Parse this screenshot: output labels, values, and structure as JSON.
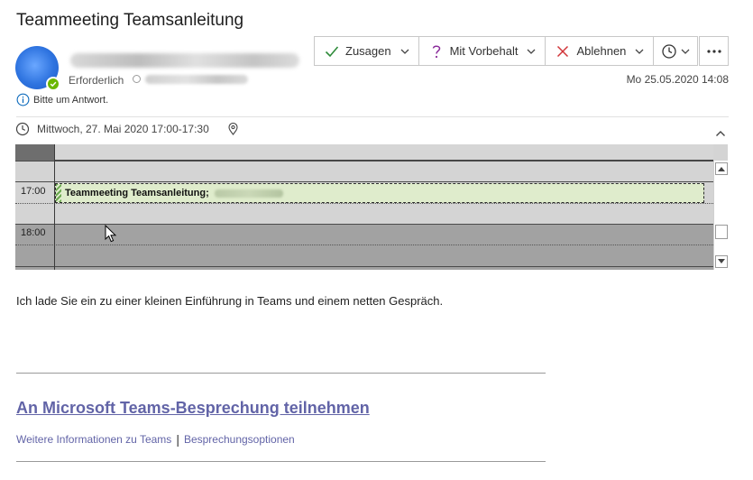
{
  "meeting": {
    "title": "Teammeeting Teamsanleitung",
    "required_label": "Erforderlich",
    "response_note": "Bitte um Antwort.",
    "sent_date": "Mo 25.05.2020 14:08",
    "when": "Mittwoch, 27. Mai 2020 17:00-17:30"
  },
  "toolbar": {
    "accept_label": "Zusagen",
    "tentative_label": "Mit Vorbehalt",
    "decline_label": "Ablehnen"
  },
  "calendar": {
    "times": [
      "17:00",
      "18:00"
    ],
    "event_label": "Teammeeting Teamsanleitung;"
  },
  "body": {
    "message": "Ich lade Sie ein zu einer kleinen Einführung in Teams und einem netten Gespräch.",
    "join_link": "An Microsoft Teams-Besprechung teilnehmen",
    "more_info_link": "Weitere Informationen zu Teams",
    "separator": "|",
    "options_link": "Besprechungsoptionen"
  },
  "colors": {
    "accept": "#2e8b3a",
    "tentative": "#8b2d9b",
    "decline": "#d13438",
    "presence": "#6bb700",
    "teams_link": "#6264a7",
    "event_fill": "#dfeccc"
  },
  "icons": {
    "presence": "check-icon",
    "info": "info-icon",
    "accept": "check-icon",
    "tentative": "question-icon",
    "decline": "x-icon",
    "snooze": "clock-icon",
    "more": "ellipsis-icon",
    "when": "clock-icon",
    "location": "location-pin-icon",
    "collapse": "chevron-up-icon"
  }
}
